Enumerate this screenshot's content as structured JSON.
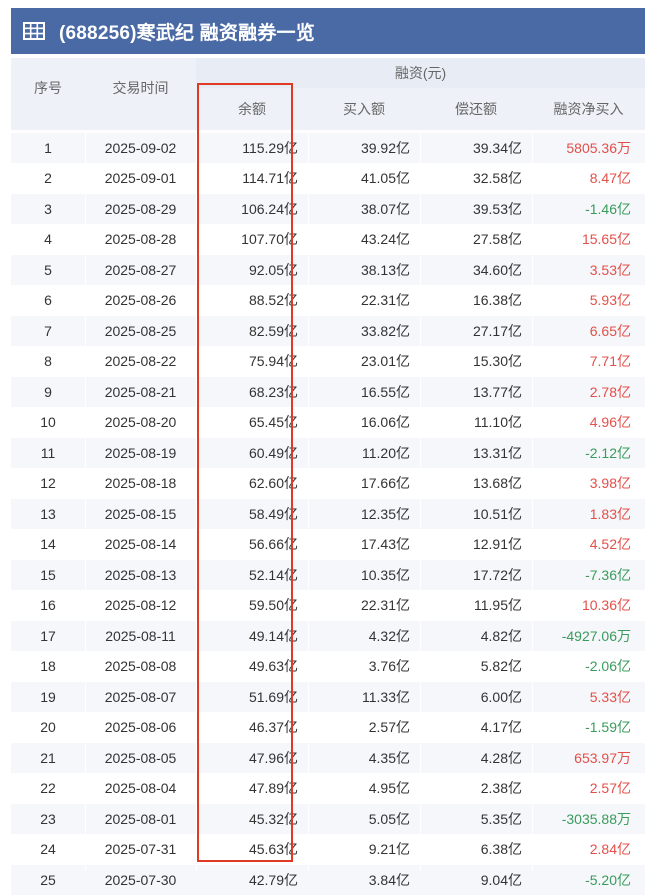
{
  "header": {
    "title": "(688256)寒武纪 融资融券一览",
    "icon": "table-icon",
    "background": "#4a6aa6"
  },
  "columns": {
    "index": "序号",
    "date": "交易时间",
    "group": "融资(元)",
    "balance": "余额",
    "buy": "买入额",
    "repay": "偿还额",
    "net": "融资净买入"
  },
  "colors": {
    "positive": "#e2504a",
    "negative": "#3a9b5c",
    "highlight_border": "#e03a24"
  },
  "rows": [
    {
      "idx": "1",
      "date": "2025-09-02",
      "balance": "115.29亿",
      "buy": "39.92亿",
      "repay": "39.34亿",
      "net": "5805.36万",
      "sign": "pos"
    },
    {
      "idx": "2",
      "date": "2025-09-01",
      "balance": "114.71亿",
      "buy": "41.05亿",
      "repay": "32.58亿",
      "net": "8.47亿",
      "sign": "pos"
    },
    {
      "idx": "3",
      "date": "2025-08-29",
      "balance": "106.24亿",
      "buy": "38.07亿",
      "repay": "39.53亿",
      "net": "-1.46亿",
      "sign": "neg"
    },
    {
      "idx": "4",
      "date": "2025-08-28",
      "balance": "107.70亿",
      "buy": "43.24亿",
      "repay": "27.58亿",
      "net": "15.65亿",
      "sign": "pos"
    },
    {
      "idx": "5",
      "date": "2025-08-27",
      "balance": "92.05亿",
      "buy": "38.13亿",
      "repay": "34.60亿",
      "net": "3.53亿",
      "sign": "pos"
    },
    {
      "idx": "6",
      "date": "2025-08-26",
      "balance": "88.52亿",
      "buy": "22.31亿",
      "repay": "16.38亿",
      "net": "5.93亿",
      "sign": "pos"
    },
    {
      "idx": "7",
      "date": "2025-08-25",
      "balance": "82.59亿",
      "buy": "33.82亿",
      "repay": "27.17亿",
      "net": "6.65亿",
      "sign": "pos"
    },
    {
      "idx": "8",
      "date": "2025-08-22",
      "balance": "75.94亿",
      "buy": "23.01亿",
      "repay": "15.30亿",
      "net": "7.71亿",
      "sign": "pos"
    },
    {
      "idx": "9",
      "date": "2025-08-21",
      "balance": "68.23亿",
      "buy": "16.55亿",
      "repay": "13.77亿",
      "net": "2.78亿",
      "sign": "pos"
    },
    {
      "idx": "10",
      "date": "2025-08-20",
      "balance": "65.45亿",
      "buy": "16.06亿",
      "repay": "11.10亿",
      "net": "4.96亿",
      "sign": "pos"
    },
    {
      "idx": "11",
      "date": "2025-08-19",
      "balance": "60.49亿",
      "buy": "11.20亿",
      "repay": "13.31亿",
      "net": "-2.12亿",
      "sign": "neg"
    },
    {
      "idx": "12",
      "date": "2025-08-18",
      "balance": "62.60亿",
      "buy": "17.66亿",
      "repay": "13.68亿",
      "net": "3.98亿",
      "sign": "pos"
    },
    {
      "idx": "13",
      "date": "2025-08-15",
      "balance": "58.49亿",
      "buy": "12.35亿",
      "repay": "10.51亿",
      "net": "1.83亿",
      "sign": "pos"
    },
    {
      "idx": "14",
      "date": "2025-08-14",
      "balance": "56.66亿",
      "buy": "17.43亿",
      "repay": "12.91亿",
      "net": "4.52亿",
      "sign": "pos"
    },
    {
      "idx": "15",
      "date": "2025-08-13",
      "balance": "52.14亿",
      "buy": "10.35亿",
      "repay": "17.72亿",
      "net": "-7.36亿",
      "sign": "neg"
    },
    {
      "idx": "16",
      "date": "2025-08-12",
      "balance": "59.50亿",
      "buy": "22.31亿",
      "repay": "11.95亿",
      "net": "10.36亿",
      "sign": "pos"
    },
    {
      "idx": "17",
      "date": "2025-08-11",
      "balance": "49.14亿",
      "buy": "4.32亿",
      "repay": "4.82亿",
      "net": "-4927.06万",
      "sign": "neg"
    },
    {
      "idx": "18",
      "date": "2025-08-08",
      "balance": "49.63亿",
      "buy": "3.76亿",
      "repay": "5.82亿",
      "net": "-2.06亿",
      "sign": "neg"
    },
    {
      "idx": "19",
      "date": "2025-08-07",
      "balance": "51.69亿",
      "buy": "11.33亿",
      "repay": "6.00亿",
      "net": "5.33亿",
      "sign": "pos"
    },
    {
      "idx": "20",
      "date": "2025-08-06",
      "balance": "46.37亿",
      "buy": "2.57亿",
      "repay": "4.17亿",
      "net": "-1.59亿",
      "sign": "neg"
    },
    {
      "idx": "21",
      "date": "2025-08-05",
      "balance": "47.96亿",
      "buy": "4.35亿",
      "repay": "4.28亿",
      "net": "653.97万",
      "sign": "pos"
    },
    {
      "idx": "22",
      "date": "2025-08-04",
      "balance": "47.89亿",
      "buy": "4.95亿",
      "repay": "2.38亿",
      "net": "2.57亿",
      "sign": "pos"
    },
    {
      "idx": "23",
      "date": "2025-08-01",
      "balance": "45.32亿",
      "buy": "5.05亿",
      "repay": "5.35亿",
      "net": "-3035.88万",
      "sign": "neg"
    },
    {
      "idx": "24",
      "date": "2025-07-31",
      "balance": "45.63亿",
      "buy": "9.21亿",
      "repay": "6.38亿",
      "net": "2.84亿",
      "sign": "pos"
    },
    {
      "idx": "25",
      "date": "2025-07-30",
      "balance": "42.79亿",
      "buy": "3.84亿",
      "repay": "9.04亿",
      "net": "-5.20亿",
      "sign": "neg"
    }
  ]
}
